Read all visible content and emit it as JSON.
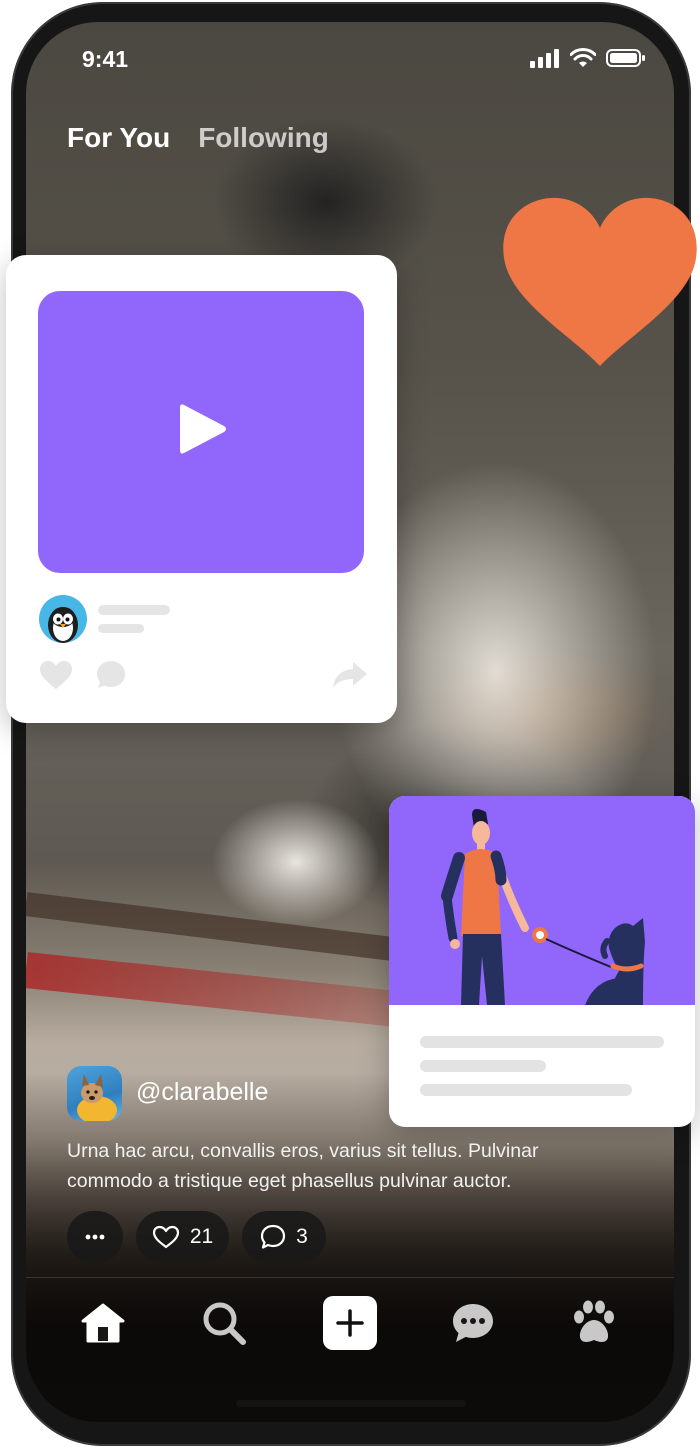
{
  "status_bar": {
    "time": "9:41"
  },
  "tabs": [
    {
      "label": "For You",
      "active": true
    },
    {
      "label": "Following",
      "active": false
    }
  ],
  "post": {
    "username": "@clarabelle",
    "caption": "Urna hac arcu, convallis eros, varius sit tellus. Pulvinar commodo a tristique eget phasellus pulvinar auctor.",
    "likes": "21",
    "comments": "3"
  },
  "icons": {
    "like": "heart-icon",
    "comment": "comment-icon",
    "more": "more-icon",
    "share": "share-icon",
    "play": "play-icon"
  },
  "nav": [
    {
      "name": "home",
      "icon": "home-icon"
    },
    {
      "name": "search",
      "icon": "search-icon"
    },
    {
      "name": "create",
      "icon": "plus-icon"
    },
    {
      "name": "messages",
      "icon": "chat-icon"
    },
    {
      "name": "pets",
      "icon": "paw-icon"
    }
  ],
  "colors": {
    "accent_purple": "#9066fb",
    "heart_orange": "#ef7645",
    "penguin_blue": "#46b7e6"
  }
}
